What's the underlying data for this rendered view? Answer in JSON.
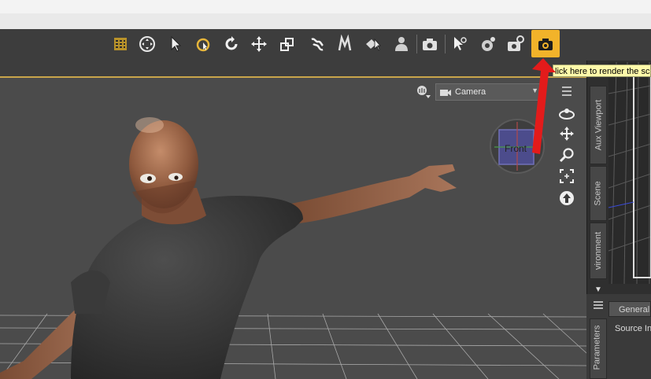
{
  "toolbar": {
    "tools": [
      {
        "name": "joint-editor-icon",
        "active": false
      },
      {
        "name": "universal-tool-icon",
        "active": false
      },
      {
        "name": "node-selection-icon",
        "active": false
      },
      {
        "name": "rotate-selection-icon",
        "active": false
      },
      {
        "name": "rotate-tool-icon",
        "active": false
      },
      {
        "name": "translate-tool-icon",
        "active": false
      },
      {
        "name": "scale-tool-icon",
        "active": false
      },
      {
        "name": "active-pose-icon",
        "active": false
      },
      {
        "name": "transfer-tool-icon",
        "active": false
      },
      {
        "name": "surface-selection-icon",
        "active": false
      },
      {
        "name": "figure-tool-icon",
        "active": false
      },
      {
        "name": "spot-render-icon",
        "active": false
      },
      {
        "name": "geometry-editor-icon",
        "active": false
      },
      {
        "name": "render-settings-icon",
        "active": false
      },
      {
        "name": "render-settings-gear-icon",
        "active": false
      },
      {
        "name": "render-camera-icon",
        "active": true
      }
    ]
  },
  "tooltip": {
    "text": "lick here to render the sc"
  },
  "viewport": {
    "camera_label": "Camera",
    "cube_label": "Front"
  },
  "side_tabs": {
    "aux_viewport": "Aux Viewport",
    "scene": "Scene",
    "environment": "vironment",
    "parameters": "Parameters"
  },
  "params": {
    "tab_general": "General",
    "source_label": "Source In"
  },
  "colors": {
    "accent": "#f2b32a",
    "tooltip_bg": "#fffaaa",
    "arrow": "#e31b1b"
  }
}
